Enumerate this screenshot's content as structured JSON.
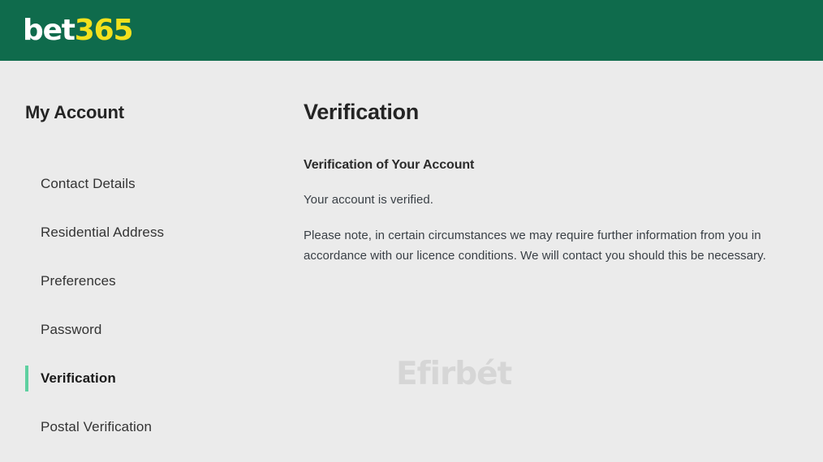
{
  "header": {
    "brand": {
      "icon": "bet365-logo",
      "text_primary": "bet",
      "text_accent": "365"
    },
    "background_color": "#0f6b4c",
    "primary_color": "#ffffff",
    "accent_color": "#f3e11d"
  },
  "sidebar": {
    "title": "My Account",
    "active_accent_color": "#5ed0a0",
    "items": [
      {
        "label": "Contact Details",
        "active": false
      },
      {
        "label": "Residential Address",
        "active": false
      },
      {
        "label": "Preferences",
        "active": false
      },
      {
        "label": "Password",
        "active": false
      },
      {
        "label": "Verification",
        "active": true
      },
      {
        "label": "Postal Verification",
        "active": false
      }
    ]
  },
  "main": {
    "title": "Verification",
    "subtitle": "Verification of Your Account",
    "paragraphs": [
      "Your account is verified.",
      "Please note, in certain circumstances we may require further information from you in accordance with our licence conditions. We will contact you should this be necessary."
    ]
  },
  "watermark": {
    "text": "Efirbét",
    "color": "#d6d6d6"
  }
}
